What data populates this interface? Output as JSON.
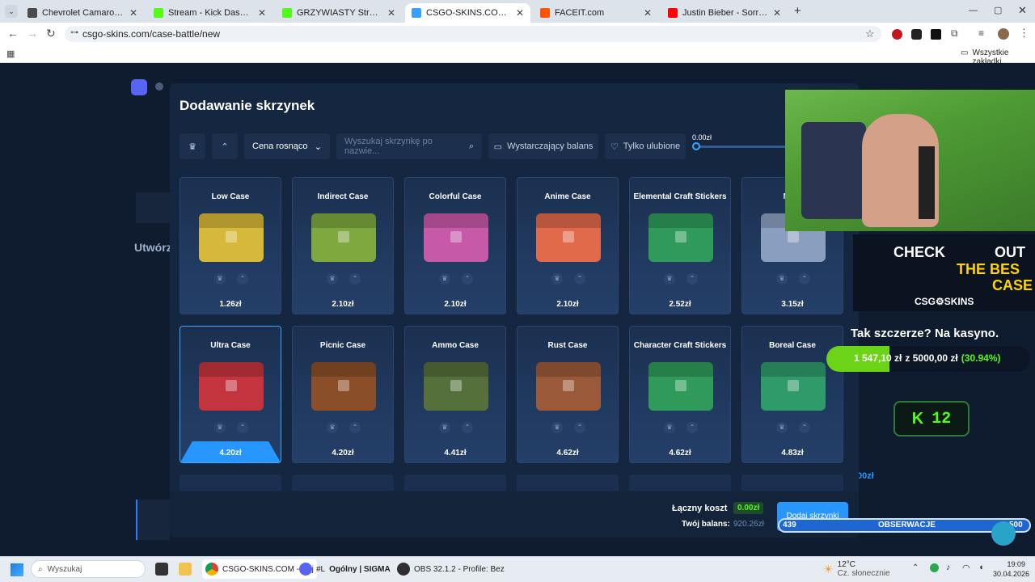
{
  "browser": {
    "tabs": [
      {
        "title": "Chevrolet Camaro - Samochod",
        "color": "#4a4a4a"
      },
      {
        "title": "Stream - Kick Dashboard",
        "color": "#53fc18"
      },
      {
        "title": "GRZYWIASTY Stream - Watch L",
        "color": "#53fc18"
      },
      {
        "title": "CSGO-SKINS.COM - Najlepsze",
        "color": "#3aa0ff"
      },
      {
        "title": "FACEIT.com",
        "color": "#ff5500"
      },
      {
        "title": "Justin Bieber - Sorry (PURP",
        "color": "#ff0000"
      }
    ],
    "url": "csgo-skins.com/case-battle/new",
    "bookmarks_label": "Wszystkie zakładki"
  },
  "modal": {
    "title": "Dodawanie skrzynek",
    "sort_label": "Cena rosnąco",
    "search_placeholder": "Wyszukaj skrzynkę po nazwie...",
    "balance_filter": "Wystarczający balans",
    "favorites_filter": "Tylko ulubione",
    "price_min": "0.00zł",
    "cases": [
      {
        "name": "Low Case",
        "price": "1.26zł",
        "color": "#d6b83a"
      },
      {
        "name": "Indirect Case",
        "price": "2.10zł",
        "color": "#7fa83f"
      },
      {
        "name": "Colorful Case",
        "price": "2.10zł",
        "color": "#c75aa8"
      },
      {
        "name": "Anime Case",
        "price": "2.10zł",
        "color": "#e06a4a"
      },
      {
        "name": "Elemental Craft Stickers",
        "price": "2.52zł",
        "color": "#2f9a5a"
      },
      {
        "name": "Medi",
        "price": "3.15zł",
        "color": "#8a9fc0"
      },
      {
        "name": "Ultra Case",
        "price": "4.20zł",
        "color": "#c4343e"
      },
      {
        "name": "Picnic Case",
        "price": "4.20zł",
        "color": "#8a4f28"
      },
      {
        "name": "Ammo Case",
        "price": "4.41zł",
        "color": "#55703a"
      },
      {
        "name": "Rust Case",
        "price": "4.62zł",
        "color": "#9a5a3a"
      },
      {
        "name": "Character Craft Stickers",
        "price": "4.62zł",
        "color": "#2f9a5a"
      },
      {
        "name": "Boreal Case",
        "price": "4.83zł",
        "color": "#2f9a6a"
      }
    ],
    "total_cost_label": "Łączny koszt",
    "total_cost": "0.00zł",
    "balance_label": "Twój balans:",
    "balance": "920.26zł",
    "add_button": "Dodaj skrzynki"
  },
  "stream_overlay": {
    "promo_line1": "CHECK",
    "promo_line2": "OUT",
    "promo_line3": "THE BES",
    "promo_line4": "CASE",
    "promo_brand": "CSG⚙SKINS",
    "tagline": "Tak szczerze? Na kasyno.",
    "progress_value": "1 547,10 zł",
    "progress_total": "z 5000,00 zł",
    "progress_percent": "(30.94%)",
    "progress_fraction": 0.3094,
    "kick_count": "12",
    "follow_left": "439",
    "follow_label": "OBSERWACJE",
    "follow_right": "500",
    "side_amount": ".00zł"
  },
  "taskbar": {
    "search_placeholder": "Wyszukaj",
    "chrome_label": "CSGO-SKINS.COM - Naj",
    "discord_label": "#L",
    "discord2_label": "Ogólny | SIGMA",
    "obs_label": "OBS 32.1.2 - Profile: Bez",
    "weather_temp": "12°C",
    "weather_desc": "Cz. słonecznie",
    "time": "19:09",
    "date": "30.04.2026"
  }
}
